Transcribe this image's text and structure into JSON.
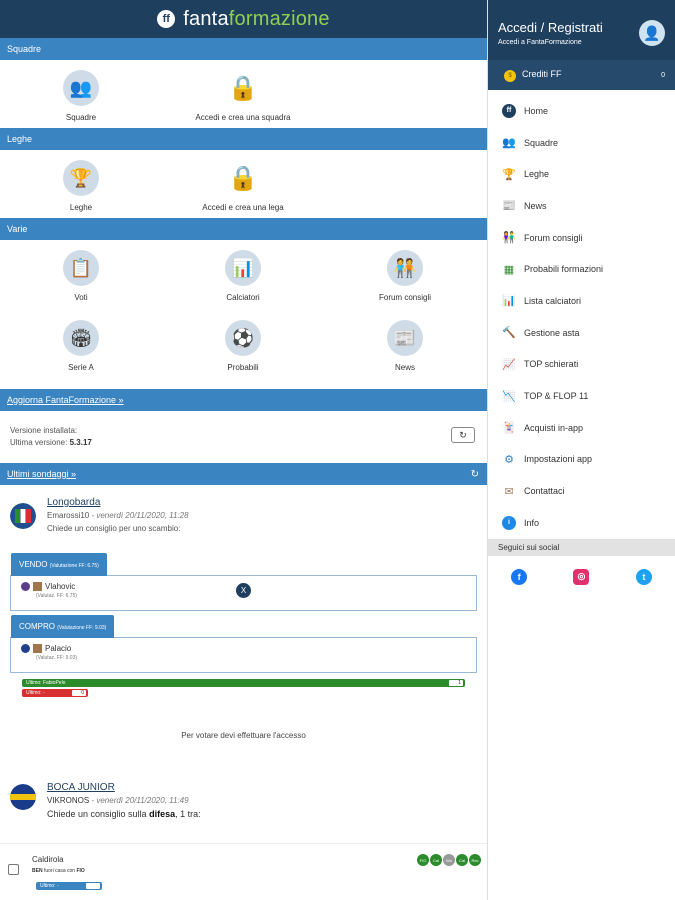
{
  "appbar": {
    "brand_part1": "fanta",
    "brand_part2": "formazione",
    "logo_mark": "ff"
  },
  "sections": {
    "squadre": "Squadre",
    "leghe": "Leghe",
    "varie": "Varie",
    "aggiorna": "Aggiorna FantaFormazione »",
    "sondaggi": "Ultimi sondaggi »"
  },
  "squadre": {
    "item": "Squadre",
    "lock_label": "Accedi e crea una squadra"
  },
  "leghe": {
    "item": "Leghe",
    "lock_label": "Accedi e crea una lega"
  },
  "varie": {
    "items": [
      {
        "label": "Voti",
        "icon": "clipboard-icon"
      },
      {
        "label": "Calciatori",
        "icon": "stats-icon"
      },
      {
        "label": "Forum consigli",
        "icon": "people-icon"
      },
      {
        "label": "Serie A",
        "icon": "stadium-icon"
      },
      {
        "label": "Probabili",
        "icon": "field-icon"
      },
      {
        "label": "News",
        "icon": "news-icon"
      }
    ]
  },
  "version": {
    "installed_label": "Versione installata:",
    "latest_label": "Ultima versione:",
    "latest_value": "5.3.17"
  },
  "poll1": {
    "team": "Longobarda",
    "user": "Emarossi10",
    "date": " - venerdì 20/11/2020, 11:28",
    "question": "Chiede un consiglio per uno scambio:",
    "sell_label": "VENDO",
    "sell_val": "(Valutazione FF: 6.75)",
    "sell_player": "Vlahovic",
    "sell_player_val": "(Valutaz. FF: 6.75)",
    "buy_label": "COMPRO",
    "buy_val": "(Valutazione FF: 9.03)",
    "buy_player": "Palacio",
    "buy_player_val": "(Valutaz. FF: 9.03)",
    "x_label": "X",
    "vote_green_label": "Ultimo: FabioPelo",
    "vote_green_count": "1",
    "vote_red_label": "Ultimo: -",
    "vote_red_count": "0",
    "login_note": "Per votare devi effettuare l'accesso"
  },
  "poll2": {
    "team": "BOCA JUNIOR",
    "user": "VIKRONOS",
    "date": " - venerdì 20/11/2020, 11:49",
    "question_prefix": "Chiede un consiglio sulla ",
    "question_bold": "difesa",
    "question_suffix": ", 1 tra:",
    "player_name": "Caldirola",
    "player_sub_prefix": "BEN",
    "player_sub_text": " fuori casa con ",
    "player_sub_team": "FIO",
    "player_bar_label": "Ultimo: -",
    "badges": [
      "FIO",
      "Cal",
      "Wo",
      "Cal",
      "Rec"
    ]
  },
  "drawer": {
    "title": "Accedi / Registrati",
    "subtitle": "Accedi a FantaFormazione",
    "credits_label": "Crediti FF",
    "credits_count": "0",
    "menu": [
      {
        "label": "Home",
        "icon": "ff-logo-icon",
        "color": "#1f3f5f"
      },
      {
        "label": "Squadre",
        "icon": "team-icon",
        "color": "#5b2a86"
      },
      {
        "label": "Leghe",
        "icon": "trophy-icon",
        "color": "#d99a1a"
      },
      {
        "label": "News",
        "icon": "news-icon",
        "color": "#3a84c2"
      },
      {
        "label": "Forum consigli",
        "icon": "people-icon",
        "color": "#c0504d"
      },
      {
        "label": "Probabili formazioni",
        "icon": "field-icon",
        "color": "#2c8c2c"
      },
      {
        "label": "Lista calciatori",
        "icon": "stats-icon",
        "color": "#e08a2c"
      },
      {
        "label": "Gestione asta",
        "icon": "gavel-icon",
        "color": "#8b5a2b"
      },
      {
        "label": "TOP schierati",
        "icon": "chart-up-icon",
        "color": "#c0504d"
      },
      {
        "label": "TOP & FLOP 11",
        "icon": "chart-icon",
        "color": "#2c8c2c"
      },
      {
        "label": "Acquisti in-app",
        "icon": "cards-icon",
        "color": "#5b6bbf"
      },
      {
        "label": "Impostazioni app",
        "icon": "settings-icon",
        "color": "#3a84c2"
      },
      {
        "label": "Contattaci",
        "icon": "mail-icon",
        "color": "#a47c5c"
      },
      {
        "label": "Info",
        "icon": "info-icon",
        "color": "#1e88e5"
      }
    ],
    "social_header": "Seguici sui social",
    "social": [
      {
        "icon": "facebook-icon",
        "glyph": "f",
        "color": "#1877f2"
      },
      {
        "icon": "instagram-icon",
        "glyph": "◎",
        "color": "#e1306c"
      },
      {
        "icon": "twitter-icon",
        "glyph": "t",
        "color": "#1da1f2"
      }
    ]
  }
}
